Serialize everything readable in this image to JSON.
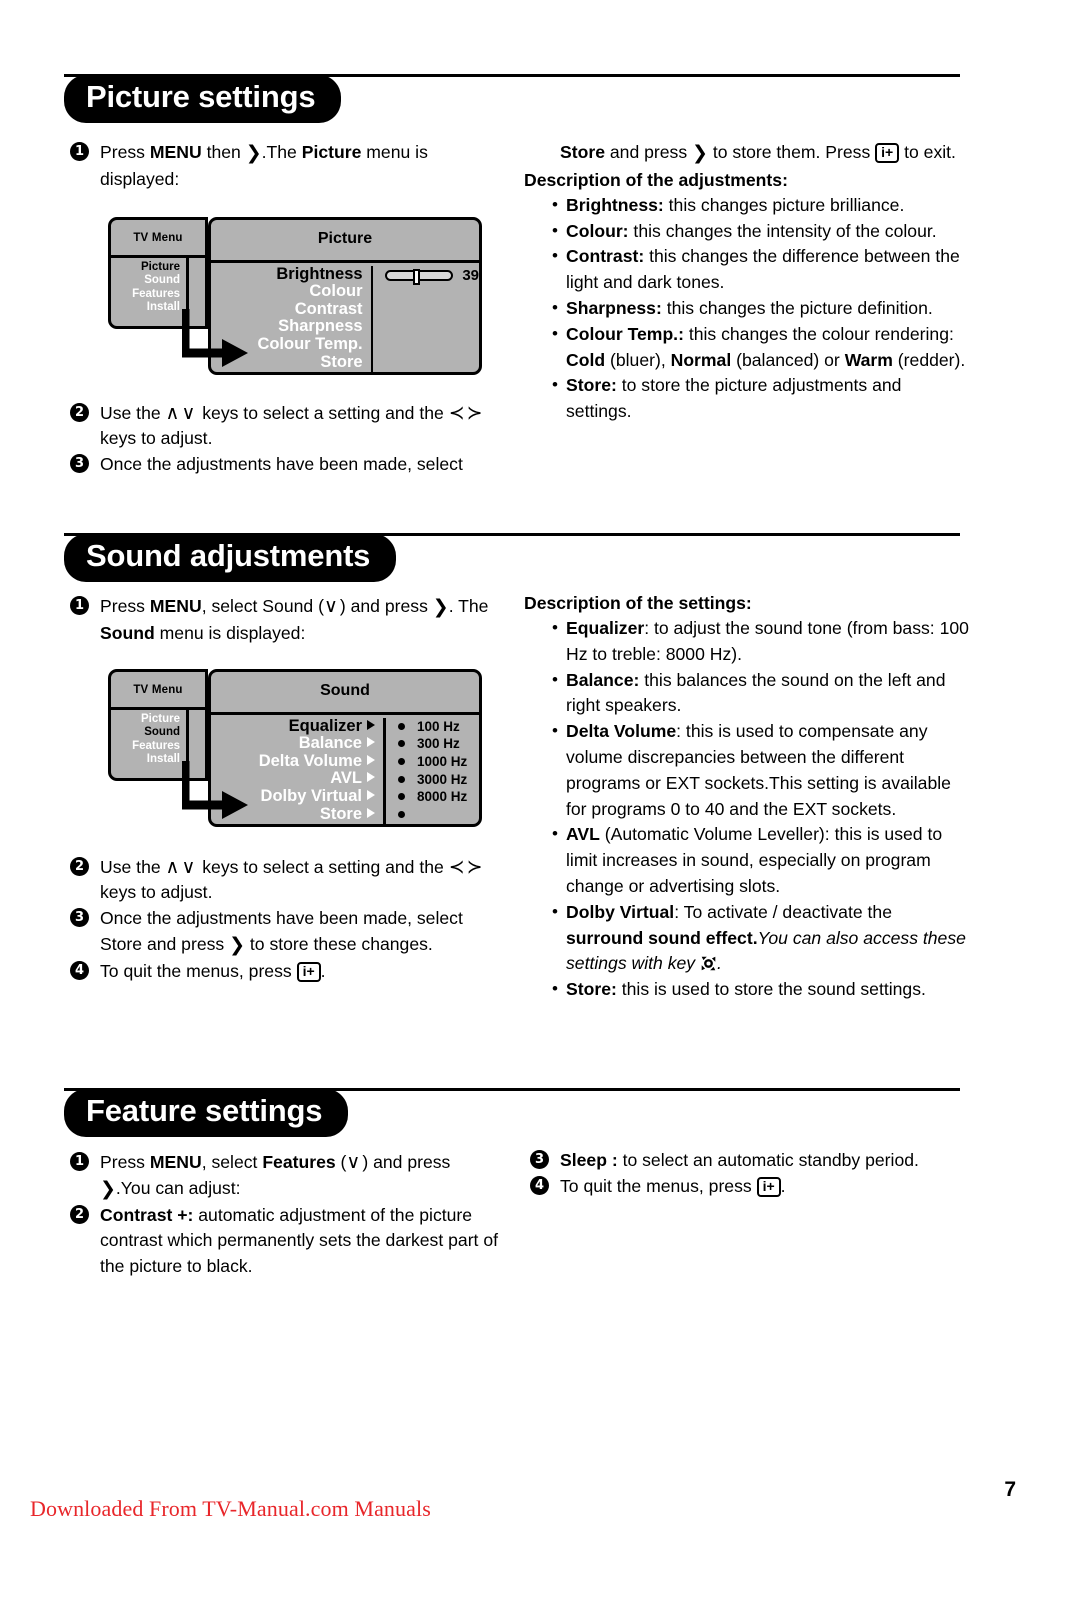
{
  "document": {
    "page_number": "7",
    "footer_note": "Downloaded From TV-Manual.com Manuals"
  },
  "sections": [
    {
      "id": "picture",
      "title": "Picture settings",
      "steps": [
        {
          "num": "❶",
          "html": "Press <b>MENU</b> then <span class=\"gt\">❯</span>.The <b>Picture</b> menu is displayed:"
        },
        {
          "num": "❷",
          "html": "Use the <span class=\"updown\">∧∨</span> keys to select a setting and the <span class=\"updown\">≺≻</span> keys to adjust."
        },
        {
          "num": "❸",
          "html": "Once the adjustments have been made, select"
        }
      ],
      "osd": {
        "left_title": "TV Menu",
        "left_items": [
          "Picture",
          "Sound",
          "Features",
          "Install"
        ],
        "left_selected_index": 0,
        "right_title": "Picture",
        "items": [
          "Brightness",
          "Colour",
          "Contrast",
          "Sharpness",
          "Colour Temp.",
          "Store"
        ],
        "selected_index": 0,
        "slider_value": "39"
      },
      "right_intro": "<b>Store</b> and press <span class=\"gt\">❯</span> to store them. Press <span class=\"keybox\">i+</span> to exit.",
      "desc_title": "Description of the adjustments:",
      "bullets": [
        "<b>Brightness:</b> this changes picture brilliance.",
        "<b>Colour:</b> this changes the intensity of the colour.",
        "<b>Contrast:</b> this changes the difference between the light and dark tones.",
        "<b>Sharpness:</b> this changes the picture definition.",
        "<b>Colour Temp.:</b> this changes the colour rendering: <b>Cold</b> (bluer), <b>Normal</b> (balanced) or <b>Warm</b> (redder).",
        "<b>Store:</b> to store the picture adjustments and settings."
      ]
    },
    {
      "id": "sound",
      "title": "Sound adjustments",
      "steps": [
        {
          "num": "❶",
          "html": "Press <b>MENU</b>, select Sound (<span class=\"updown\">∨</span>) and press <span class=\"gt\">❯</span>. The <b>Sound</b> menu is displayed:"
        },
        {
          "num": "❷",
          "html": "Use the <span class=\"updown\">∧∨</span> keys to select a setting and the <span class=\"updown\">≺≻</span> keys to adjust."
        },
        {
          "num": "❸",
          "html": "Once the adjustments have been made, select Store and press <span class=\"gt\">❯</span> to store these changes."
        },
        {
          "num": "❹",
          "html": "To quit the menus, press <span class=\"keybox\">i+</span>."
        }
      ],
      "osd": {
        "left_title": "TV Menu",
        "left_items": [
          "Picture",
          "Sound",
          "Features",
          "Install"
        ],
        "left_selected_index": 1,
        "right_title": "Sound",
        "items": [
          "Equalizer",
          "Balance",
          "Delta Volume",
          "AVL",
          "Dolby Virtual",
          "Store"
        ],
        "selected_index": 0,
        "values": [
          "100 Hz",
          "300 Hz",
          "1000 Hz",
          "3000 Hz",
          "8000 Hz",
          ""
        ]
      },
      "desc_title": "Description of the settings:",
      "bullets": [
        "<b>Equalizer</b>: to adjust the sound tone (from bass: 100 Hz to treble: 8000 Hz).",
        "<b>Balance:</b> this balances the sound on the left and right speakers.",
        "<b>Delta Volume</b>: this is used to compensate any volume discrepancies between the different programs or EXT sockets.This setting is available for programs 0 to 40 and the EXT sockets.",
        "<b>AVL</b> (Automatic Volume Leveller): this is used to limit increases in sound, especially on program change or advertising slots.",
        "<b>Dolby Virtual</b>: To activate / deactivate the <b>surround sound effect.</b><span class=\"ital\">You can also access these settings with key </span><span class=\"surr-key\"></span><span class=\"ital\">.</span>",
        "<b>Store:</b> this is used to store the sound settings."
      ]
    },
    {
      "id": "feature",
      "title": "Feature settings",
      "steps": [
        {
          "num": "❶",
          "html": "Press <b>MENU</b>, select <b>Features</b> (<span class=\"updown\">∨</span>) and press <span class=\"gt\">❯</span>.You can adjust:"
        },
        {
          "num": "❷",
          "html": "<b>Contrast +:</b> automatic adjustment of the picture contrast which permanently sets the darkest part of the picture to black."
        }
      ],
      "right_steps": [
        {
          "num": "❸",
          "html": "<b>Sleep :</b> to select an automatic standby period."
        },
        {
          "num": "❹",
          "html": "To quit the menus, press <span class=\"keybox\">i+</span>."
        }
      ]
    }
  ]
}
